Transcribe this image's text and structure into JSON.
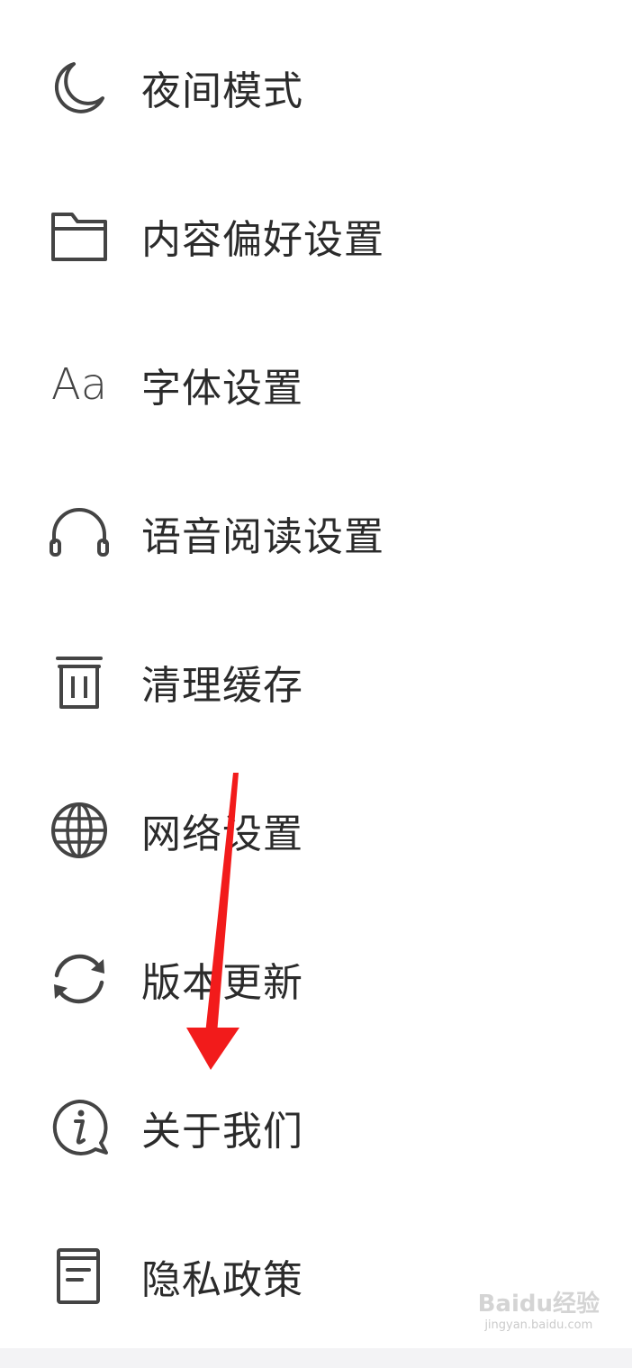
{
  "menu": {
    "items": [
      {
        "label": "夜间模式",
        "icon": "moon-icon"
      },
      {
        "label": "内容偏好设置",
        "icon": "folder-icon"
      },
      {
        "label": "字体设置",
        "icon": "font-icon",
        "icon_text": "Aa"
      },
      {
        "label": "语音阅读设置",
        "icon": "headphones-icon"
      },
      {
        "label": "清理缓存",
        "icon": "trash-icon"
      },
      {
        "label": "网络设置",
        "icon": "globe-icon"
      },
      {
        "label": "版本更新",
        "icon": "refresh-icon"
      },
      {
        "label": "关于我们",
        "icon": "info-icon"
      },
      {
        "label": "隐私政策",
        "icon": "document-icon"
      }
    ]
  },
  "annotation": {
    "arrow_color": "#f21b1b"
  },
  "watermark": {
    "main": "Baidu经验",
    "sub": "jingyan.baidu.com"
  },
  "colors": {
    "text": "#2b2b2b",
    "icon": "#444444",
    "background": "#ffffff"
  }
}
